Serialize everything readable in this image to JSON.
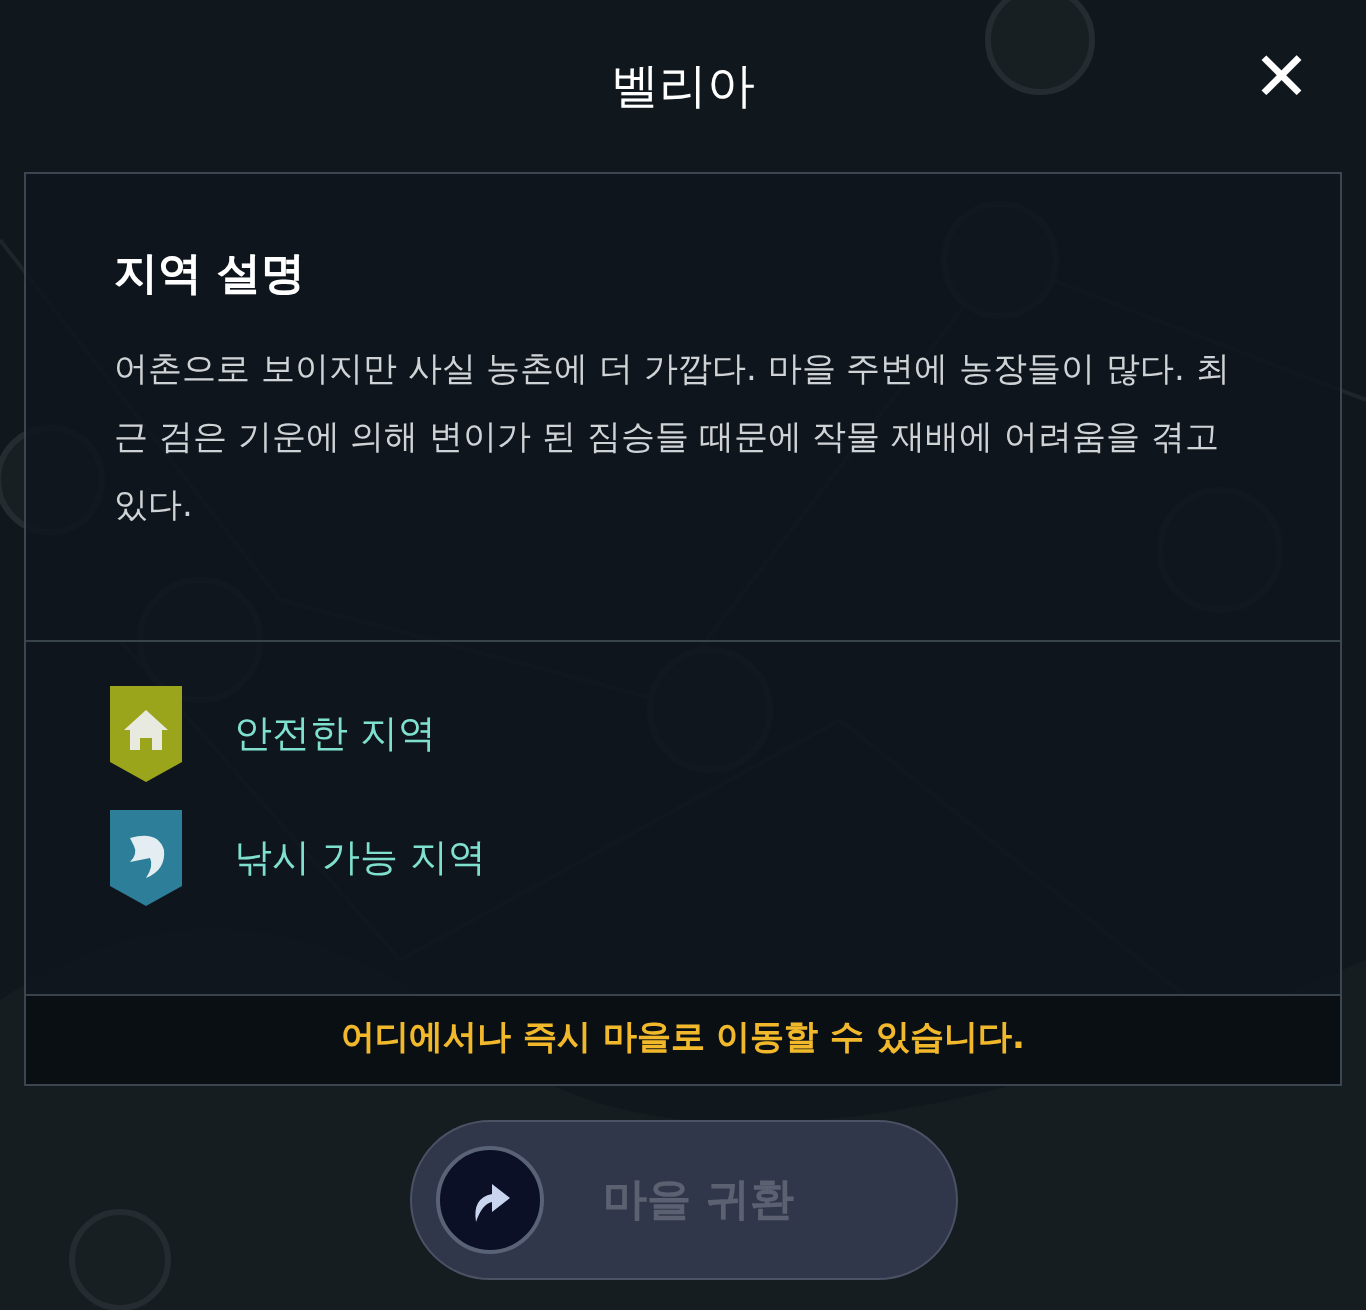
{
  "header": {
    "title": "벨리아",
    "close": "✕"
  },
  "panel": {
    "heading": "지역 설명",
    "description": "어촌으로 보이지만 사실 농촌에 더 가깝다. 마을 주변에 농장들이 많다. 최근 검은 기운에 의해 변이가 된 짐승들 때문에 작물 재배에 어려움을 겪고 있다.",
    "features": [
      {
        "kind": "safe",
        "label": "안전한 지역"
      },
      {
        "kind": "fishing",
        "label": "낚시 가능 지역"
      }
    ],
    "notice": "어디에서나 즉시 마을로 이동할 수 있습니다."
  },
  "return_button": {
    "label": "마을 귀환",
    "disabled": true
  }
}
